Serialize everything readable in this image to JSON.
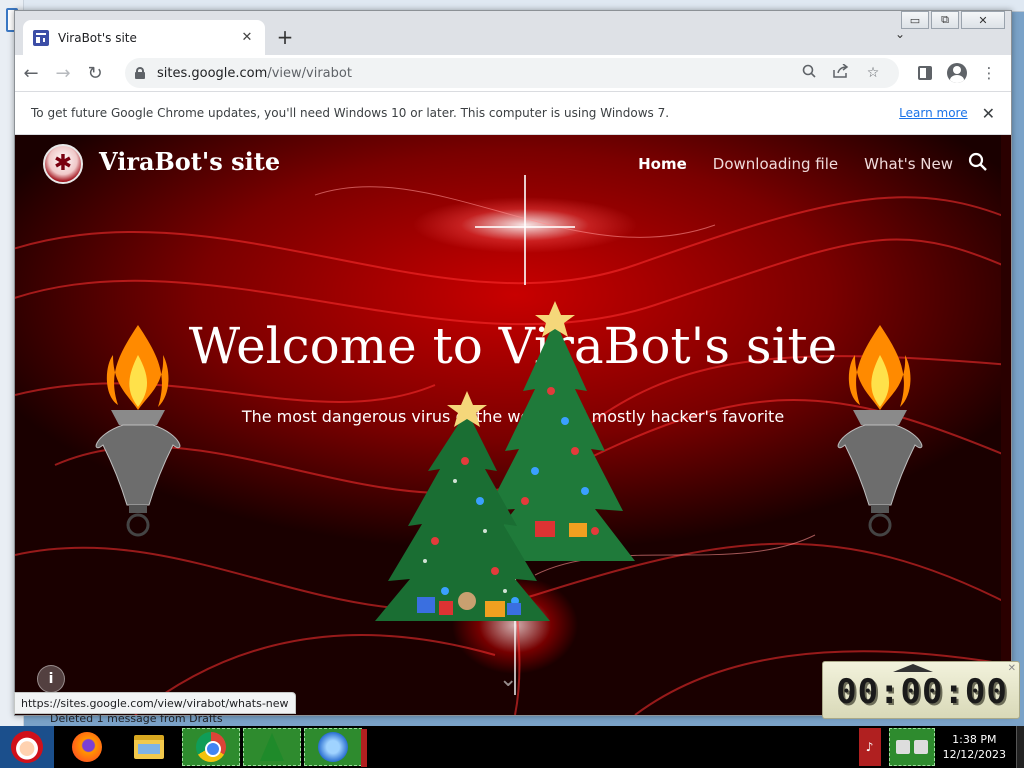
{
  "browser": {
    "tab_title": "ViraBot's site",
    "url_host": "sites.google.com",
    "url_path": "/view/virabot",
    "infobar_message": "To get future Google Chrome updates, you'll need Windows 10 or later. This computer is using Windows 7.",
    "infobar_link": "Learn more",
    "status_url": "https://sites.google.com/view/virabot/whats-new"
  },
  "site": {
    "title": "ViraBot's site",
    "nav": [
      {
        "label": "Home",
        "active": true
      },
      {
        "label": "Downloading file",
        "active": false
      },
      {
        "label": "What's New",
        "active": false
      }
    ],
    "hero_title": "Welcome to ViraBot's site",
    "hero_subtitle": "The most dangerous virus of the world and mostly hacker's favorite"
  },
  "behind_window_text": "Deleted 1 message from Drafts",
  "countdown": {
    "value": "00:00:00"
  },
  "taskbar": {
    "apps": [
      "firefox-icon",
      "file-explorer-icon",
      "chrome-icon",
      "christmas-tree-icon",
      "mail-icon"
    ],
    "clock_time": "1:38 PM",
    "clock_date": "12/12/2023"
  },
  "colors": {
    "accent_link": "#1a73e8",
    "hero_red": "#c80000",
    "taskbar_active": "#2e8b2e"
  }
}
